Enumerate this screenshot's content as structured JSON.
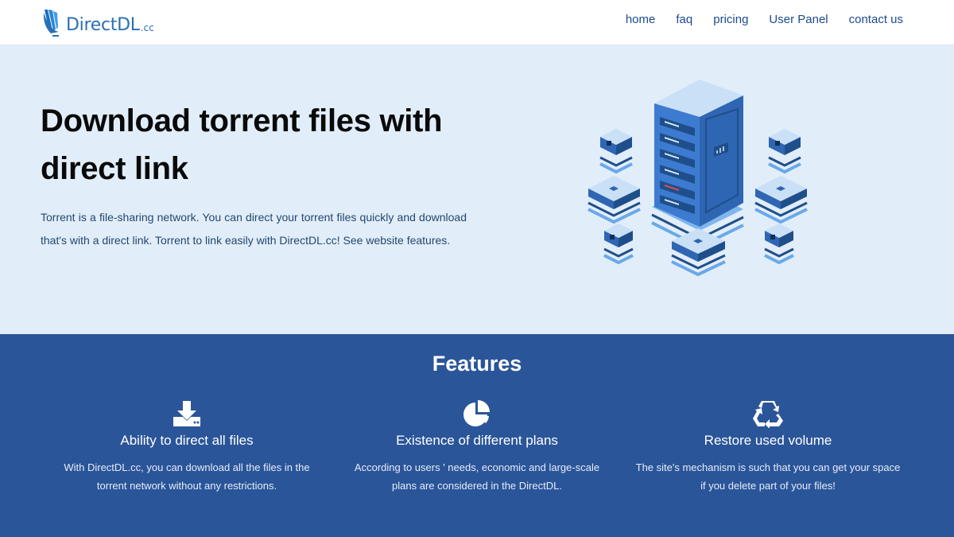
{
  "colors": {
    "brand": "#2a6fb5",
    "nav_text": "#1d4a8f",
    "hero_bg": "#e1edf9",
    "features_bg": "#2b5599"
  },
  "header": {
    "logo": {
      "name": "DirectDL",
      "suffix": ".cc",
      "icon": "logo-icon"
    },
    "nav": [
      {
        "label": "home"
      },
      {
        "label": "faq"
      },
      {
        "label": "pricing"
      },
      {
        "label": "User Panel"
      },
      {
        "label": "contact us"
      }
    ]
  },
  "hero": {
    "title": "Download torrent files with direct link",
    "description": "Torrent is a file-sharing network. You can direct your torrent files quickly and download that's with a direct link. Torrent to link easily with DirectDL.cc! See website features.",
    "illustration": "server-network-illustration"
  },
  "features": {
    "title": "Features",
    "items": [
      {
        "icon": "download-icon",
        "title": "Ability to direct all files",
        "description": "With DirectDL.cc, you can download all the files in the torrent network without any restrictions."
      },
      {
        "icon": "pie-chart-icon",
        "title": "Existence of different plans",
        "description": "According to users ' needs, economic and large-scale plans are considered in the DirectDL."
      },
      {
        "icon": "recycle-icon",
        "title": "Restore used volume",
        "description": "The site's mechanism is such that you can get your space if you delete part of your files!"
      }
    ]
  }
}
